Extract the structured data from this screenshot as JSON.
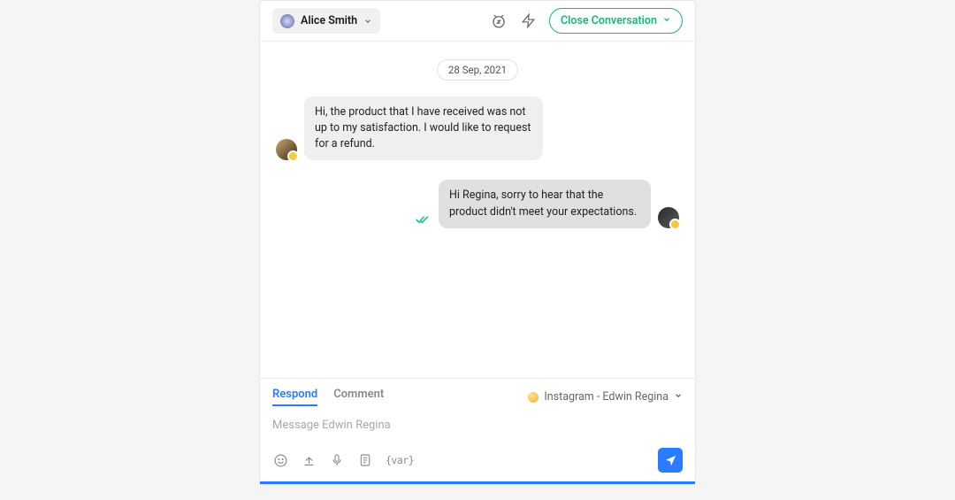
{
  "header": {
    "agent_name": "Alice Smith",
    "close_label": "Close Conversation"
  },
  "conversation": {
    "date_label": "28 Sep, 2021",
    "messages": [
      {
        "direction": "in",
        "text": "Hi, the product that I have received was not up to my satisfaction. I would like to request for a refund."
      },
      {
        "direction": "out",
        "text": "Hi Regina, sorry to hear that the product didn't meet your expectations."
      }
    ]
  },
  "composer": {
    "tabs": {
      "respond": "Respond",
      "comment": "Comment"
    },
    "channel_label": "Instagram - Edwin Regina",
    "placeholder": "Message Edwin Regina",
    "variable_label": "{var}"
  }
}
